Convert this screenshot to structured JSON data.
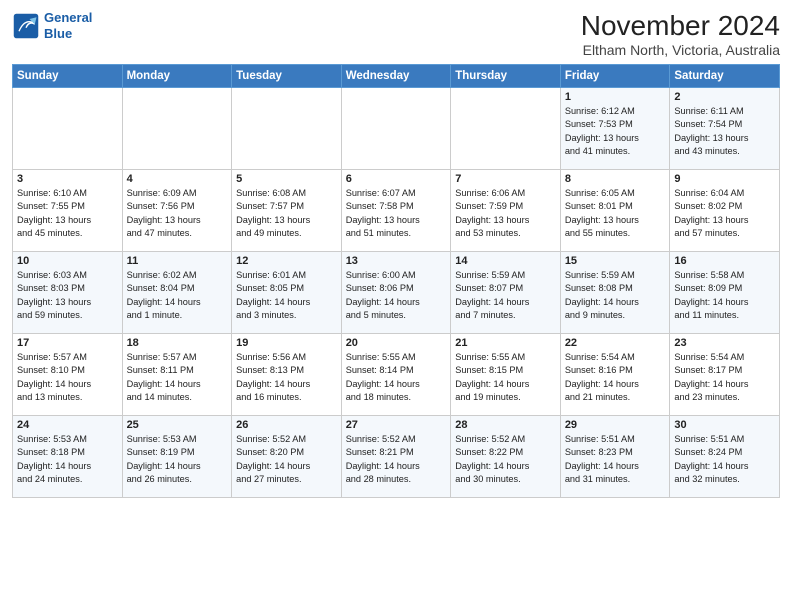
{
  "logo": {
    "line1": "General",
    "line2": "Blue"
  },
  "title": "November 2024",
  "subtitle": "Eltham North, Victoria, Australia",
  "weekdays": [
    "Sunday",
    "Monday",
    "Tuesday",
    "Wednesday",
    "Thursday",
    "Friday",
    "Saturday"
  ],
  "weeks": [
    [
      {
        "day": "",
        "info": ""
      },
      {
        "day": "",
        "info": ""
      },
      {
        "day": "",
        "info": ""
      },
      {
        "day": "",
        "info": ""
      },
      {
        "day": "",
        "info": ""
      },
      {
        "day": "1",
        "info": "Sunrise: 6:12 AM\nSunset: 7:53 PM\nDaylight: 13 hours\nand 41 minutes."
      },
      {
        "day": "2",
        "info": "Sunrise: 6:11 AM\nSunset: 7:54 PM\nDaylight: 13 hours\nand 43 minutes."
      }
    ],
    [
      {
        "day": "3",
        "info": "Sunrise: 6:10 AM\nSunset: 7:55 PM\nDaylight: 13 hours\nand 45 minutes."
      },
      {
        "day": "4",
        "info": "Sunrise: 6:09 AM\nSunset: 7:56 PM\nDaylight: 13 hours\nand 47 minutes."
      },
      {
        "day": "5",
        "info": "Sunrise: 6:08 AM\nSunset: 7:57 PM\nDaylight: 13 hours\nand 49 minutes."
      },
      {
        "day": "6",
        "info": "Sunrise: 6:07 AM\nSunset: 7:58 PM\nDaylight: 13 hours\nand 51 minutes."
      },
      {
        "day": "7",
        "info": "Sunrise: 6:06 AM\nSunset: 7:59 PM\nDaylight: 13 hours\nand 53 minutes."
      },
      {
        "day": "8",
        "info": "Sunrise: 6:05 AM\nSunset: 8:01 PM\nDaylight: 13 hours\nand 55 minutes."
      },
      {
        "day": "9",
        "info": "Sunrise: 6:04 AM\nSunset: 8:02 PM\nDaylight: 13 hours\nand 57 minutes."
      }
    ],
    [
      {
        "day": "10",
        "info": "Sunrise: 6:03 AM\nSunset: 8:03 PM\nDaylight: 13 hours\nand 59 minutes."
      },
      {
        "day": "11",
        "info": "Sunrise: 6:02 AM\nSunset: 8:04 PM\nDaylight: 14 hours\nand 1 minute."
      },
      {
        "day": "12",
        "info": "Sunrise: 6:01 AM\nSunset: 8:05 PM\nDaylight: 14 hours\nand 3 minutes."
      },
      {
        "day": "13",
        "info": "Sunrise: 6:00 AM\nSunset: 8:06 PM\nDaylight: 14 hours\nand 5 minutes."
      },
      {
        "day": "14",
        "info": "Sunrise: 5:59 AM\nSunset: 8:07 PM\nDaylight: 14 hours\nand 7 minutes."
      },
      {
        "day": "15",
        "info": "Sunrise: 5:59 AM\nSunset: 8:08 PM\nDaylight: 14 hours\nand 9 minutes."
      },
      {
        "day": "16",
        "info": "Sunrise: 5:58 AM\nSunset: 8:09 PM\nDaylight: 14 hours\nand 11 minutes."
      }
    ],
    [
      {
        "day": "17",
        "info": "Sunrise: 5:57 AM\nSunset: 8:10 PM\nDaylight: 14 hours\nand 13 minutes."
      },
      {
        "day": "18",
        "info": "Sunrise: 5:57 AM\nSunset: 8:11 PM\nDaylight: 14 hours\nand 14 minutes."
      },
      {
        "day": "19",
        "info": "Sunrise: 5:56 AM\nSunset: 8:13 PM\nDaylight: 14 hours\nand 16 minutes."
      },
      {
        "day": "20",
        "info": "Sunrise: 5:55 AM\nSunset: 8:14 PM\nDaylight: 14 hours\nand 18 minutes."
      },
      {
        "day": "21",
        "info": "Sunrise: 5:55 AM\nSunset: 8:15 PM\nDaylight: 14 hours\nand 19 minutes."
      },
      {
        "day": "22",
        "info": "Sunrise: 5:54 AM\nSunset: 8:16 PM\nDaylight: 14 hours\nand 21 minutes."
      },
      {
        "day": "23",
        "info": "Sunrise: 5:54 AM\nSunset: 8:17 PM\nDaylight: 14 hours\nand 23 minutes."
      }
    ],
    [
      {
        "day": "24",
        "info": "Sunrise: 5:53 AM\nSunset: 8:18 PM\nDaylight: 14 hours\nand 24 minutes."
      },
      {
        "day": "25",
        "info": "Sunrise: 5:53 AM\nSunset: 8:19 PM\nDaylight: 14 hours\nand 26 minutes."
      },
      {
        "day": "26",
        "info": "Sunrise: 5:52 AM\nSunset: 8:20 PM\nDaylight: 14 hours\nand 27 minutes."
      },
      {
        "day": "27",
        "info": "Sunrise: 5:52 AM\nSunset: 8:21 PM\nDaylight: 14 hours\nand 28 minutes."
      },
      {
        "day": "28",
        "info": "Sunrise: 5:52 AM\nSunset: 8:22 PM\nDaylight: 14 hours\nand 30 minutes."
      },
      {
        "day": "29",
        "info": "Sunrise: 5:51 AM\nSunset: 8:23 PM\nDaylight: 14 hours\nand 31 minutes."
      },
      {
        "day": "30",
        "info": "Sunrise: 5:51 AM\nSunset: 8:24 PM\nDaylight: 14 hours\nand 32 minutes."
      }
    ]
  ]
}
